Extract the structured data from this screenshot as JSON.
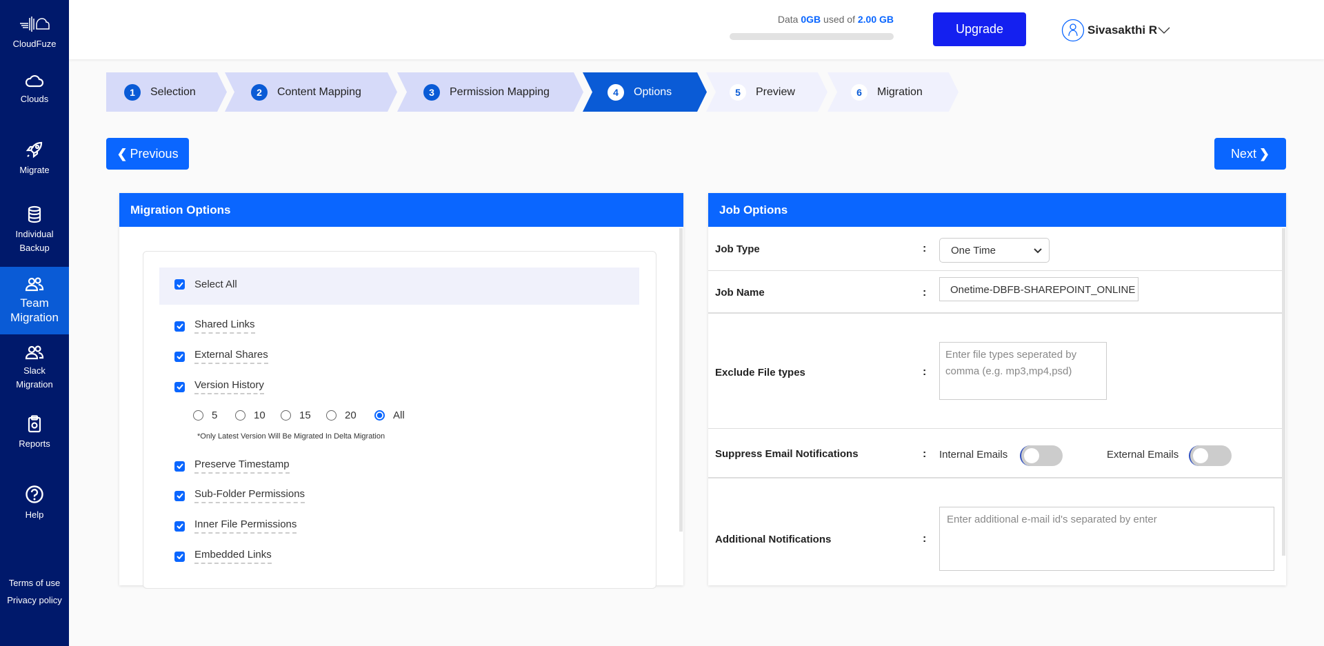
{
  "sidebar": {
    "brand": "CloudFuze",
    "items": [
      {
        "label": "Clouds",
        "icon": "cloud-icon"
      },
      {
        "label": "Migrate",
        "icon": "rocket-icon"
      },
      {
        "label1": "Individual",
        "label2": "Backup",
        "icon": "database-icon"
      },
      {
        "label1": "Team",
        "label2": "Migration",
        "icon": "users-icon",
        "active": true
      },
      {
        "label1": "Slack",
        "label2": "Migration",
        "icon": "users-icon"
      },
      {
        "label": "Reports",
        "icon": "clipboard-icon"
      },
      {
        "label": "Help",
        "icon": "help-icon"
      }
    ],
    "terms": "Terms of use",
    "privacy": "Privacy policy"
  },
  "header": {
    "data_prefix": "Data ",
    "data_used": "0GB",
    "data_mid": " used of ",
    "data_total": "2.00 GB",
    "usage_fraction": 0,
    "upgrade": "Upgrade",
    "user": "Sivasakthi R"
  },
  "steps": [
    {
      "n": "1",
      "label": "Selection"
    },
    {
      "n": "2",
      "label": "Content Mapping"
    },
    {
      "n": "3",
      "label": "Permission Mapping"
    },
    {
      "n": "4",
      "label": "Options"
    },
    {
      "n": "5",
      "label": "Preview"
    },
    {
      "n": "6",
      "label": "Migration"
    }
  ],
  "nav": {
    "previous": "Previous",
    "next": "Next"
  },
  "migration_options": {
    "title": "Migration Options",
    "select_all": "Select All",
    "items": [
      "Shared Links",
      "External Shares",
      "Version History",
      "Preserve Timestamp",
      "Sub-Folder Permissions",
      "Inner File Permissions",
      "Embedded Links"
    ],
    "versions": [
      "5",
      "10",
      "15",
      "20",
      "All"
    ],
    "selected_version": "All",
    "note": "*Only Latest Version Will Be Migrated In Delta Migration"
  },
  "job_options": {
    "title": "Job Options",
    "colon": ":",
    "job_type_label": "Job Type",
    "job_type": "One Time",
    "job_name_label": "Job Name",
    "job_name": "Onetime-DBFB-SHAREPOINT_ONLINE",
    "exclude_label": "Exclude File types",
    "exclude_placeholder": "Enter file types seperated by comma (e.g. mp3,mp4,psd)",
    "suppress_label": "Suppress Email Notifications",
    "internal": "Internal Emails",
    "external": "External Emails",
    "internal_on": false,
    "external_on": false,
    "additional_label": "Additional Notifications",
    "additional_placeholder": "Enter additional e-mail id's separated by enter"
  },
  "colors": {
    "sidebar": "#00196b",
    "accent": "#0a66ff",
    "upgrade": "#1420f0"
  }
}
